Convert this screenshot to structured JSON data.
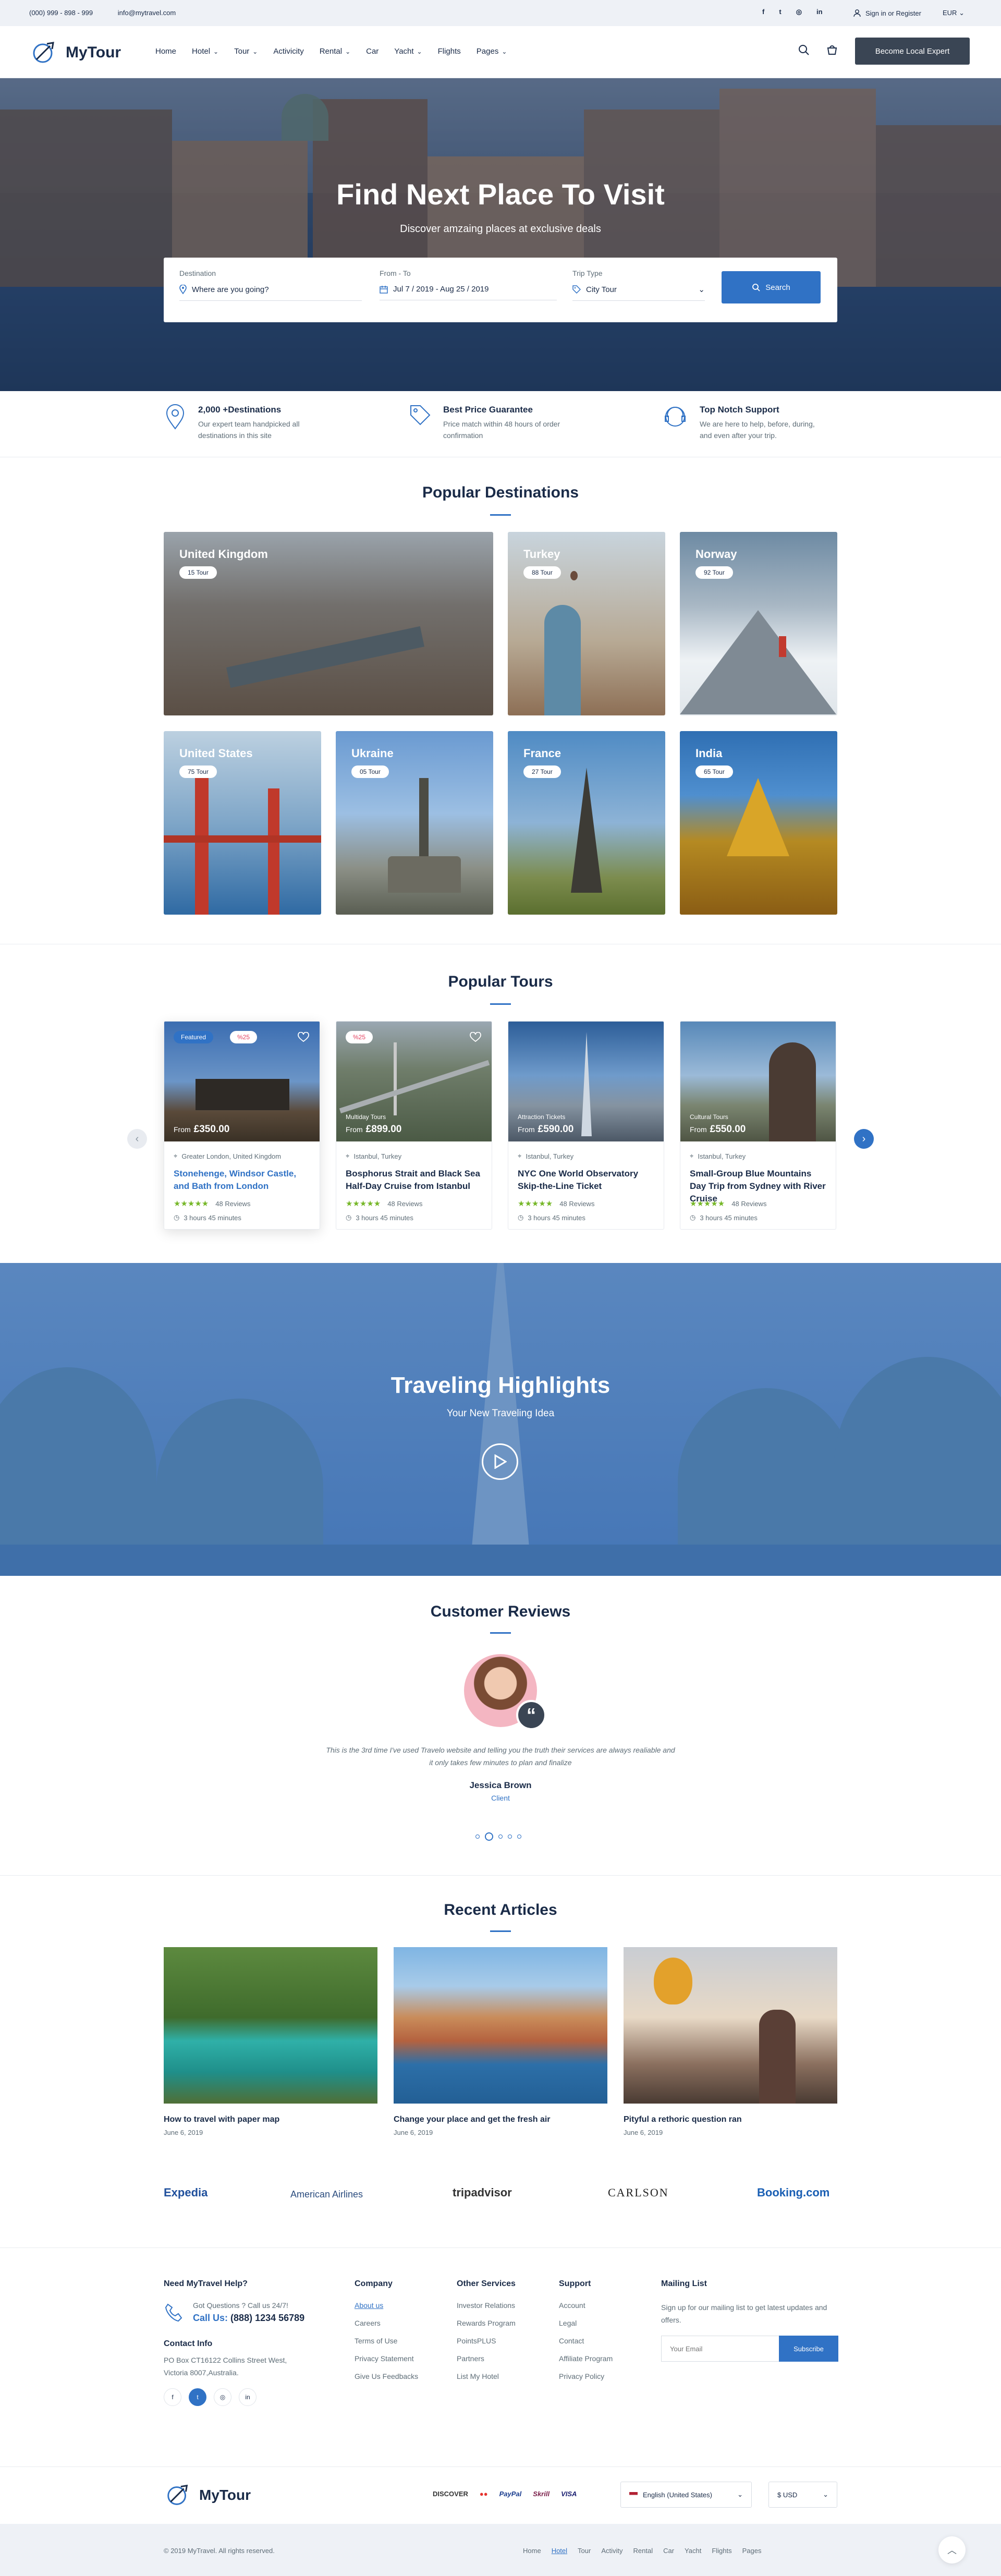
{
  "topbar": {
    "phone": "(000) 999 - 898 - 999",
    "email": "info@mytravel.com",
    "social": [
      "f",
      "t",
      "◎",
      "in"
    ],
    "account": "Sign in or Register",
    "currency": "EUR"
  },
  "header": {
    "brand": "MyTour",
    "nav": [
      {
        "label": "Home",
        "dropdown": false
      },
      {
        "label": "Hotel",
        "dropdown": true
      },
      {
        "label": "Tour",
        "dropdown": true
      },
      {
        "label": "Activicity",
        "dropdown": false
      },
      {
        "label": "Rental",
        "dropdown": true
      },
      {
        "label": "Car",
        "dropdown": false
      },
      {
        "label": "Yacht",
        "dropdown": true
      },
      {
        "label": "Flights",
        "dropdown": false
      },
      {
        "label": "Pages",
        "dropdown": true
      }
    ],
    "cta": "Become Local Expert"
  },
  "hero": {
    "title": "Find Next Place To Visit",
    "subtitle": "Discover amzaing places at exclusive deals",
    "search": {
      "destination_label": "Destination",
      "destination_placeholder": "Where are you going?",
      "dates_label": "From - To",
      "dates_value": "Jul 7 / 2019 - Aug 25 / 2019",
      "trip_label": "Trip Type",
      "trip_value": "City Tour",
      "button": "Search"
    }
  },
  "features": [
    {
      "title": "2,000 +Destinations",
      "desc": "Our expert team handpicked all destinations in this site"
    },
    {
      "title": "Best Price Guarantee",
      "desc": "Price match within 48 hours of order confirmation"
    },
    {
      "title": "Top Notch Support",
      "desc": "We are here to help, before, during, and even after your trip."
    }
  ],
  "destinations": {
    "title": "Popular Destinations",
    "items": [
      {
        "name": "United Kingdom",
        "tours": "15 Tour"
      },
      {
        "name": "Turkey",
        "tours": "88 Tour"
      },
      {
        "name": "Norway",
        "tours": "92 Tour"
      },
      {
        "name": "United States",
        "tours": "75 Tour"
      },
      {
        "name": "Ukraine",
        "tours": "05 Tour"
      },
      {
        "name": "France",
        "tours": "27 Tour"
      },
      {
        "name": "India",
        "tours": "65 Tour"
      }
    ]
  },
  "tours": {
    "title": "Popular Tours",
    "items": [
      {
        "category": "",
        "from": "From",
        "price": "£350.00",
        "location": "Greater London, United Kingdom",
        "title": "Stonehenge, Windsor Castle, and Bath from London",
        "reviews": "48 Reviews",
        "duration": "3 hours 45 minutes",
        "badge_featured": "Featured",
        "badge_discount": "%25"
      },
      {
        "category": "Multiday Tours",
        "from": "From",
        "price": "£899.00",
        "location": "Istanbul, Turkey",
        "title": "Bosphorus Strait and Black Sea Half-Day Cruise from Istanbul",
        "reviews": "48 Reviews",
        "duration": "3 hours 45 minutes",
        "badge_discount": "%25"
      },
      {
        "category": "Attraction Tickets",
        "from": "From",
        "price": "£590.00",
        "location": "Istanbul, Turkey",
        "title": "NYC One World Observatory Skip-the-Line Ticket",
        "reviews": "48 Reviews",
        "duration": "3 hours 45 minutes"
      },
      {
        "category": "Cultural Tours",
        "from": "From",
        "price": "£550.00",
        "location": "Istanbul, Turkey",
        "title": "Small-Group Blue Mountains Day Trip from Sydney with River Cruise",
        "reviews": "48 Reviews",
        "duration": "3 hours 45 minutes"
      }
    ]
  },
  "highlights": {
    "title": "Traveling Highlights",
    "subtitle": "Your New Traveling Idea"
  },
  "reviews": {
    "title": "Customer Reviews",
    "quote": "This is the 3rd time I've used Travelo website and telling you the truth their services are always realiable and it only takes few minutes to plan and finalize",
    "name": "Jessica Brown",
    "role": "Client"
  },
  "articles": {
    "title": "Recent Articles",
    "items": [
      {
        "title": "How to travel with paper map",
        "date": "June 6, 2019"
      },
      {
        "title": "Change your place and get the fresh air",
        "date": "June 6, 2019"
      },
      {
        "title": "Pityful a rethoric question ran",
        "date": "June 6, 2019"
      }
    ]
  },
  "partners": [
    "Expedia",
    "American Airlines",
    "tripadvisor",
    "CARLSON",
    "Booking.com"
  ],
  "footer": {
    "help_title": "Need MyTravel Help?",
    "help_question": "Got Questions ? Call us 24/7!",
    "call_label": "Call Us:",
    "call_number": "(888) 1234 56789",
    "contact_title": "Contact Info",
    "address": "PO Box CT16122 Collins Street West, Victoria 8007,Australia.",
    "company_title": "Company",
    "company_links": [
      "About us",
      "Careers",
      "Terms of Use",
      "Privacy Statement",
      "Give Us Feedbacks"
    ],
    "services_title": "Other Services",
    "services_links": [
      "Investor Relations",
      "Rewards Program",
      "PointsPLUS",
      "Partners",
      "List My Hotel"
    ],
    "support_title": "Support",
    "support_links": [
      "Account",
      "Legal",
      "Contact",
      "Affiliate Program",
      "Privacy Policy"
    ],
    "mailing_title": "Mailing List",
    "mailing_desc": "Sign up for our mailing list to get latest updates and offers.",
    "email_placeholder": "Your Email",
    "subscribe": "Subscribe",
    "payments": [
      "DISCOVER",
      "●●",
      "PayPal",
      "Skrill",
      "VISA"
    ],
    "language": "English (United States)",
    "currency": "$ USD",
    "copyright": "© 2019 MyTravel. All rights reserved.",
    "bottom_links": [
      "Home",
      "Hotel",
      "Tour",
      "Activity",
      "Rental",
      "Car",
      "Yacht",
      "Flights",
      "Pages"
    ]
  },
  "colors": {
    "accent": "#3072c5",
    "dark": "#1a2b48",
    "muted": "#5e6d77",
    "star": "#76b728",
    "badge_red": "#e4415f"
  }
}
